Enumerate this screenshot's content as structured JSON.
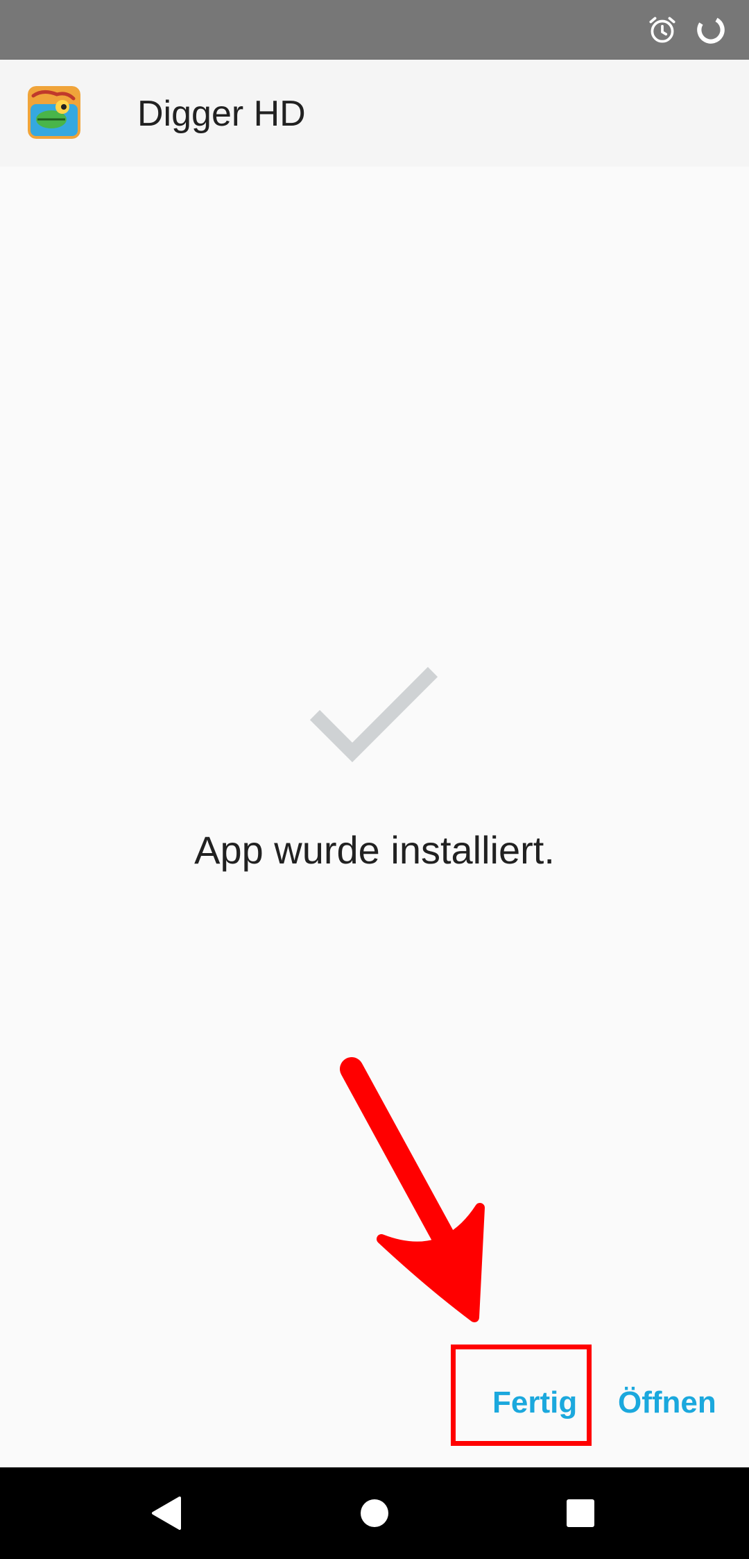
{
  "status_bar": {
    "icons": [
      "alarm-icon",
      "loading-spinner-icon"
    ]
  },
  "app_bar": {
    "title": "Digger HD",
    "icon": "digger-hd-app-icon"
  },
  "content": {
    "status_icon": "checkmark-icon",
    "message": "App wurde installiert."
  },
  "actions": {
    "done_label": "Fertig",
    "open_label": "Öffnen"
  },
  "annotation": {
    "arrow_color": "#ff0000",
    "highlight_color": "#ff0000",
    "highlight_target": "Fertig"
  },
  "nav_bar": {
    "buttons": [
      "back-icon",
      "home-icon",
      "recents-icon"
    ]
  },
  "colors": {
    "accent": "#1ba8dd",
    "status_bar": "#777777",
    "app_bar": "#f5f5f5",
    "background": "#fafafa",
    "checkmark": "#cfd2d4",
    "nav_bar": "#000000"
  }
}
